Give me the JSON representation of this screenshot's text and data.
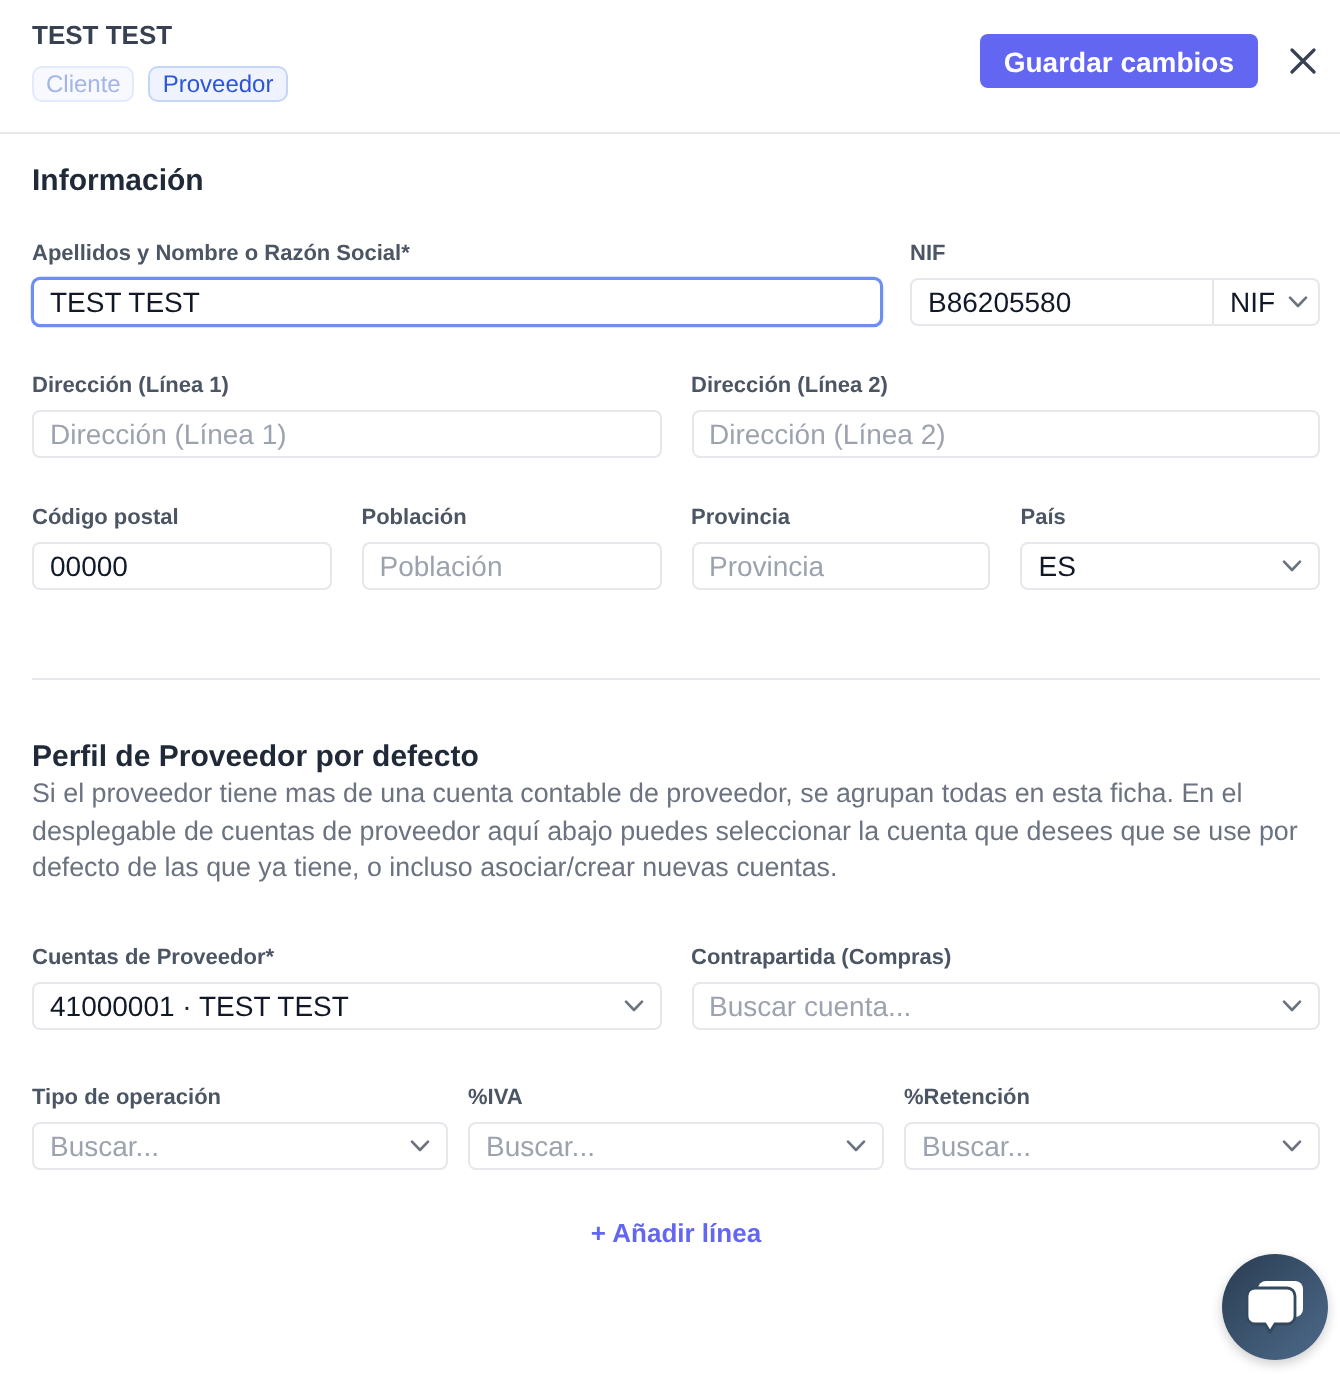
{
  "header": {
    "title": "TEST TEST",
    "tags": [
      {
        "label": "Cliente",
        "selected": false
      },
      {
        "label": "Proveedor",
        "selected": true
      }
    ],
    "save_button": "Guardar cambios"
  },
  "sections": [
    {
      "title": "Información",
      "rows": [
        {
          "fields": [
            {
              "kind": "text",
              "label": "Apellidos y Nombre o Razón Social*",
              "value": "TEST TEST",
              "focused": true
            },
            {
              "kind": "text_with_select",
              "label": "NIF",
              "value": "B86205580",
              "select_value": "NIF",
              "focused": false
            }
          ]
        },
        {
          "fields": [
            {
              "kind": "text",
              "label": "Dirección (Línea 1)",
              "placeholder": "Dirección (Línea 1)",
              "focused": false
            },
            {
              "kind": "text",
              "label": "Dirección (Línea 2)",
              "placeholder": "Dirección (Línea 2)",
              "focused": false
            }
          ]
        },
        {
          "fields": [
            {
              "kind": "text",
              "label": "Código postal",
              "value": "00000",
              "focused": false
            },
            {
              "kind": "text",
              "label": "Población",
              "placeholder": "Población",
              "focused": false
            },
            {
              "kind": "text",
              "label": "Provincia",
              "placeholder": "Provincia",
              "focused": false
            },
            {
              "kind": "select",
              "label": "País",
              "value": "ES",
              "focused": false
            }
          ]
        }
      ]
    },
    {
      "title": "Perfil de Proveedor por defecto",
      "description": "Si el proveedor tiene mas de una cuenta contable de proveedor, se agrupan todas en esta ficha. En el desplegable de cuentas de proveedor aquí abajo puedes seleccionar la cuenta que desees que se use por defecto de las que ya tiene, o incluso asociar/crear nuevas cuentas.",
      "rows": [
        {
          "fields": [
            {
              "kind": "select",
              "label": "Cuentas de Proveedor*",
              "value": "41000001 · TEST TEST",
              "focused": false
            },
            {
              "kind": "select",
              "label": "Contrapartida (Compras)",
              "placeholder": "Buscar cuenta...",
              "focused": false
            }
          ]
        },
        {
          "fields": [
            {
              "kind": "select",
              "label": "Tipo de operación",
              "placeholder": "Buscar...",
              "focused": false
            },
            {
              "kind": "select",
              "label": "%IVA",
              "placeholder": "Buscar...",
              "focused": false
            },
            {
              "kind": "select",
              "label": "%Retención",
              "placeholder": "Buscar...",
              "focused": false
            }
          ]
        }
      ],
      "add_link": "+ Añadir línea"
    }
  ]
}
